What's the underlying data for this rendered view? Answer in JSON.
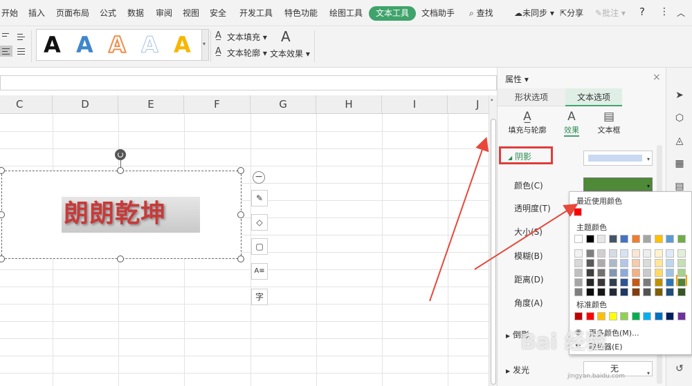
{
  "menubar": {
    "items": [
      "开始",
      "插入",
      "页面布局",
      "公式",
      "数据",
      "审阅",
      "视图",
      "安全",
      "开发工具",
      "特色功能",
      "绘图工具"
    ],
    "active": "文本工具",
    "after": "文档助手",
    "search": "查找",
    "sync": "未同步",
    "share": "分享",
    "comment": "批注",
    "help": "?",
    "more": "⋮",
    "collapse": "︿"
  },
  "ribbon": {
    "text_fill": "文本填充",
    "text_outline": "文本轮廓",
    "text_effects": "文本效果",
    "art_styles": [
      {
        "glyph": "A",
        "color": "#111111"
      },
      {
        "glyph": "A",
        "color": "#3f86cc"
      },
      {
        "glyph": "A",
        "color": "#ef8d4d"
      },
      {
        "glyph": "A",
        "color": "#a9c3e4"
      },
      {
        "glyph": "A",
        "color": "#f7b600"
      }
    ]
  },
  "sheet": {
    "columns": [
      "C",
      "D",
      "E",
      "F",
      "G",
      "H",
      "I",
      "J"
    ],
    "art_text": "朗朗乾坤"
  },
  "float_tools": [
    {
      "name": "collapse-icon",
      "glyph": "−"
    },
    {
      "name": "pen-icon",
      "glyph": "✎"
    },
    {
      "name": "fill-icon",
      "glyph": "◇"
    },
    {
      "name": "border-icon",
      "glyph": "▢"
    },
    {
      "name": "textbox-icon",
      "glyph": "A≡"
    },
    {
      "name": "char-icon",
      "glyph": "字"
    }
  ],
  "properties": {
    "title": "属性",
    "close": "×",
    "tabs": {
      "shape": "形状选项",
      "text": "文本选项"
    },
    "subtabs": {
      "fill_outline": "填充与轮廓",
      "effects": "效果",
      "textbox": "文本框"
    },
    "shadow": {
      "section": "阴影",
      "rows": [
        "颜色(C)",
        "透明度(T)",
        "大小(S)",
        "模糊(B)",
        "距离(D)",
        "角度(A)"
      ]
    },
    "reflection": "倒影",
    "glow": "发光",
    "glow_value": "无",
    "colors": {
      "shadow_color": "#4e8a37",
      "accent": "#3fa36b"
    }
  },
  "color_popup": {
    "recent_title": "最近使用颜色",
    "recent": [
      "#ff0000"
    ],
    "theme_title": "主题颜色",
    "theme_top": [
      "#ffffff",
      "#000000",
      "#e7e6e6",
      "#44546a",
      "#4472c4",
      "#ed7d31",
      "#a5a5a5",
      "#ffc000",
      "#5b9bd5",
      "#70ad47"
    ],
    "theme_shades": [
      [
        "#f2f2f2",
        "#7f7f7f",
        "#d0cece",
        "#d6dce4",
        "#d9e2f3",
        "#fbe5d5",
        "#ededed",
        "#fff2cc",
        "#deebf6",
        "#e2efd9"
      ],
      [
        "#d8d8d8",
        "#595959",
        "#aeabab",
        "#adb9ca",
        "#b4c6e7",
        "#f7cbac",
        "#dbdbdb",
        "#fee599",
        "#bdd7ee",
        "#c5e0b3"
      ],
      [
        "#bfbfbf",
        "#3f3f3f",
        "#757070",
        "#8496b0",
        "#8eaadb",
        "#f4b183",
        "#c9c9c9",
        "#ffd965",
        "#9cc3e5",
        "#a8d08d"
      ],
      [
        "#a5a5a5",
        "#262626",
        "#3a3838",
        "#323f4f",
        "#2f5496",
        "#c55a11",
        "#7b7b7b",
        "#bf9000",
        "#2e75b5",
        "#538135"
      ],
      [
        "#7f7f7f",
        "#0c0c0c",
        "#171616",
        "#222a35",
        "#1f3864",
        "#833c0b",
        "#525252",
        "#7f6000",
        "#1e4e79",
        "#375623"
      ]
    ],
    "standard_title": "标准颜色",
    "standard": [
      "#c00000",
      "#ff0000",
      "#ffc000",
      "#ffff00",
      "#92d050",
      "#00b050",
      "#00b0f0",
      "#0070c0",
      "#002060",
      "#7030a0"
    ],
    "more_colors": "更多颜色(M)...",
    "eyedropper": "取色器(E)"
  },
  "watermark": {
    "text": "Bai 经验",
    "url": "jingyan.baidu.com"
  }
}
